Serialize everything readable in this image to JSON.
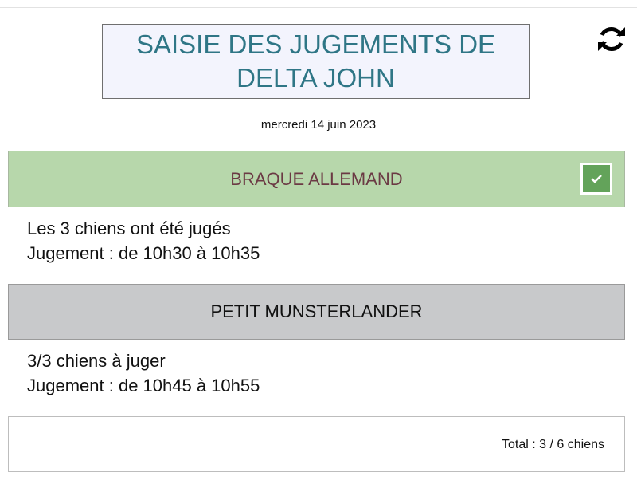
{
  "header": {
    "title_line1": "SAISIE DES JUGEMENTS DE",
    "title_line2": "DELTA JOHN",
    "refresh_icon": "refresh-icon",
    "date": "mercredi 14 juin 2023"
  },
  "colors": {
    "title_text": "#2f7686",
    "title_bg": "#f3f4fd",
    "done_header_bg": "#b7d7ab",
    "done_header_text": "#6b3a44",
    "pending_header_bg": "#c8c9cb",
    "check_bg": "#63a35a"
  },
  "breeds": [
    {
      "name": "BRAQUE ALLEMAND",
      "status": "completed",
      "status_icon": "checkbox-checked-icon",
      "status_line": "Les 3 chiens ont été jugés",
      "schedule": "Jugement : de 10h30 à 10h35"
    },
    {
      "name": "PETIT MUNSTERLANDER",
      "status": "pending",
      "status_line": "3/3 chiens à juger",
      "schedule": "Jugement : de 10h45 à 10h55"
    }
  ],
  "footer": {
    "total": "Total : 3 / 6 chiens"
  }
}
